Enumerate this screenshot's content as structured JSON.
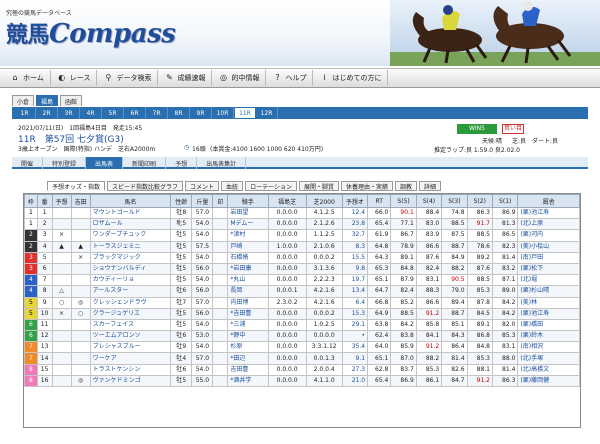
{
  "header": {
    "tagline": "究極の競馬データベース",
    "logo_kanji": "競馬",
    "logo_text": "Compass"
  },
  "nav": [
    {
      "label": "ホーム",
      "icon": "home-icon",
      "glyph": "⌂"
    },
    {
      "label": "レース",
      "icon": "race-icon",
      "glyph": "◐"
    },
    {
      "label": "データ検索",
      "icon": "data-search-icon",
      "glyph": "⚲"
    },
    {
      "label": "成績速報",
      "icon": "results-icon",
      "glyph": "✎"
    },
    {
      "label": "的中情報",
      "icon": "hit-info-icon",
      "glyph": "◎"
    },
    {
      "label": "ヘルプ",
      "icon": "help-icon",
      "glyph": "?"
    },
    {
      "label": "はじめての方に",
      "icon": "beginner-icon",
      "glyph": "i"
    }
  ],
  "venues": [
    "小倉",
    "福島",
    "函館"
  ],
  "active_venue": 1,
  "race_tabs": [
    "1R",
    "2R",
    "3R",
    "4R",
    "5R",
    "6R",
    "7R",
    "8R",
    "9R",
    "10R",
    "11R",
    "12R"
  ],
  "active_race": 10,
  "race": {
    "date_line": "2021/07/11(日)　1回福島4日目　発走15:45",
    "title": "11R　第57回 七夕賞(G3)",
    "conditions": "3歳上オープン　国際(特指) ハンデ　芝右A2000m",
    "runners": "16頭",
    "prize": "(本賞金:4100 1600 1000 620 410万円)",
    "badge_wins": "WIN5",
    "badge_bet": "買い目",
    "weather": "天候:晴",
    "going_label": "芝:良",
    "track_label": "ダート:良",
    "pace": "推定ラップ:良 1.59.0 良2.02.0"
  },
  "sub_tabs": [
    "開催",
    "特別登録",
    "出馬表",
    "新聞印刷",
    "予想",
    "出馬表集計"
  ],
  "active_sub": 2,
  "view_tabs": [
    "予想オッズ・指数",
    "スピード指数比較グラフ",
    "コメント",
    "血統",
    "ローテーション",
    "展開・脚質",
    "休養理由・実績",
    "調教",
    "詳細"
  ],
  "active_view": 0,
  "columns": [
    "枠",
    "番",
    "予想",
    "吉田",
    "馬名",
    "性齢",
    "斤量",
    "印",
    "騎手",
    "福島芝",
    "芝2000",
    "予想オ",
    "RT",
    "S(5)",
    "S(4)",
    "S(3)",
    "S(2)",
    "S(1)",
    "厩舎"
  ],
  "colors": {
    "frame1": "#ffffff",
    "frame2": "#333333",
    "frame3": "#e03030",
    "frame4": "#2a62c8",
    "frame5": "#e8d53a",
    "frame6": "#33a04a",
    "frame7": "#f08a2a",
    "frame8": "#f07ab8"
  },
  "rows": [
    {
      "waku": "1",
      "umaban": "1",
      "pred": "",
      "yoshida": "",
      "name": "マウントゴールド",
      "sexage": "牡8",
      "weight": "57.0",
      "mark": "",
      "jockey": "岩田望",
      "fuku": "0.0.0.0",
      "shiba": "4.1.2.5",
      "odds": "12.4",
      "rt": "66.0",
      "s5": "90.1",
      "s4": "88.4",
      "s3": "74.8",
      "s2": "86.3",
      "s1": "86.9",
      "trainer": "(栗)池江寿"
    },
    {
      "waku": "1",
      "umaban": "2",
      "pred": "",
      "yoshida": "",
      "name": "ロザムール",
      "sexage": "牝5",
      "weight": "54.0",
      "mark": "",
      "jockey": "Mデムー",
      "fuku": "0.0.0.0",
      "shiba": "2.1.2.6",
      "odds": "23.8",
      "rt": "65.4",
      "s5": "77.1",
      "s4": "83.0",
      "s3": "88.5",
      "s2": "91.7",
      "s1": "81.3",
      "trainer": "(北)上原"
    },
    {
      "waku": "2",
      "umaban": "3",
      "pred": "×",
      "yoshida": "",
      "name": "ワンダープチュック",
      "sexage": "牡5",
      "weight": "54.0",
      "mark": "",
      "jockey": "*津村",
      "fuku": "0.0.0.0",
      "shiba": "1.1.2.5",
      "odds": "32.7",
      "rt": "61.9",
      "s5": "86.7",
      "s4": "83.9",
      "s3": "87.5",
      "s2": "88.5",
      "s1": "86.5",
      "trainer": "(栗)河内"
    },
    {
      "waku": "2",
      "umaban": "4",
      "pred": "▲",
      "yoshida": "▲",
      "name": "トーラスジェミニ",
      "sexage": "牡5",
      "weight": "57.5",
      "mark": "",
      "jockey": "戸崎",
      "fuku": "1.0.0.0",
      "shiba": "2.1.0.6",
      "odds": "8.3",
      "rt": "64.8",
      "s5": "78.9",
      "s4": "86.6",
      "s3": "88.7",
      "s2": "78.6",
      "s1": "82.3",
      "trainer": "(美)小桧山"
    },
    {
      "waku": "3",
      "umaban": "5",
      "pred": "",
      "yoshida": "×",
      "name": "ブラックマジック",
      "sexage": "牡5",
      "weight": "54.0",
      "mark": "",
      "jockey": "石橋脩",
      "fuku": "0.0.0.0",
      "shiba": "0.0.0.2",
      "odds": "15.5",
      "rt": "64.3",
      "s5": "89.1",
      "s4": "87.6",
      "s3": "84.9",
      "s2": "89.2",
      "s1": "81.4",
      "trainer": "(南)戸田"
    },
    {
      "waku": "3",
      "umaban": "6",
      "pred": "",
      "yoshida": "",
      "name": "ショウナンバルディ",
      "sexage": "牡5",
      "weight": "56.0",
      "mark": "",
      "jockey": "*岩田康",
      "fuku": "0.0.0.0",
      "shiba": "3.1.3.6",
      "odds": "9.8",
      "rt": "65.3",
      "s5": "84.8",
      "s4": "82.4",
      "s3": "88.2",
      "s2": "87.6",
      "s1": "83.2",
      "trainer": "(栗)松下"
    },
    {
      "waku": "4",
      "umaban": "7",
      "pred": "",
      "yoshida": "",
      "name": "カウディーリョ",
      "sexage": "牡5",
      "weight": "54.0",
      "mark": "",
      "jockey": "*丸山",
      "fuku": "0.0.0.0",
      "shiba": "2.2.2.3",
      "odds": "19.7",
      "rt": "65.1",
      "s5": "87.9",
      "s4": "83.1",
      "s3": "90.5",
      "s2": "88.5",
      "s1": "87.1",
      "trainer": "(北)堀"
    },
    {
      "waku": "4",
      "umaban": "8",
      "pred": "△",
      "yoshida": "",
      "name": "アールスター",
      "sexage": "牡6",
      "weight": "56.0",
      "mark": "",
      "jockey": "長岡",
      "fuku": "0.0.0.1",
      "shiba": "4.2.1.6",
      "odds": "13.4",
      "rt": "64.7",
      "s5": "82.4",
      "s4": "88.3",
      "s3": "79.0",
      "s2": "85.3",
      "s1": "89.0",
      "trainer": "(栗)杉山晴"
    },
    {
      "waku": "5",
      "umaban": "9",
      "pred": "○",
      "yoshida": "◎",
      "name": "クレッシェンドラヴ",
      "sexage": "牡7",
      "weight": "57.0",
      "mark": "",
      "jockey": "内田博",
      "fuku": "2.3.0.2",
      "shiba": "4.2.1.6",
      "odds": "6.4",
      "rt": "66.8",
      "s5": "85.2",
      "s4": "86.6",
      "s3": "89.4",
      "s2": "87.8",
      "s1": "84.2",
      "trainer": "(美)林"
    },
    {
      "waku": "5",
      "umaban": "10",
      "pred": "×",
      "yoshida": "○",
      "name": "クラージュゲリエ",
      "sexage": "牡5",
      "weight": "56.0",
      "mark": "",
      "jockey": "*吉田豊",
      "fuku": "0.0.0.0",
      "shiba": "0.0.0.2",
      "odds": "15.3",
      "rt": "64.9",
      "s5": "88.5",
      "s4": "91.2",
      "s3": "88.7",
      "s2": "84.5",
      "s1": "84.2",
      "trainer": "(栗)池江寿"
    },
    {
      "waku": "6",
      "umaban": "11",
      "pred": "",
      "yoshida": "",
      "name": "スカーフェイス",
      "sexage": "牡5",
      "weight": "54.0",
      "mark": "",
      "jockey": "*三浦",
      "fuku": "0.0.0.0",
      "shiba": "1.0.2.5",
      "odds": "29.1",
      "rt": "63.8",
      "s5": "84.2",
      "s4": "85.8",
      "s3": "85.1",
      "s2": "89.1",
      "s1": "82.0",
      "trainer": "(栗)橋田"
    },
    {
      "waku": "6",
      "umaban": "12",
      "pred": "",
      "yoshida": "",
      "name": "ツーエムアロンソ",
      "sexage": "牡6",
      "weight": "53.0",
      "mark": "",
      "jockey": "*野中",
      "fuku": "0.0.0.0",
      "shiba": "0.0.0.0",
      "odds": "•",
      "rt": "62.4",
      "s5": "83.8",
      "s4": "84.1",
      "s3": "84.3",
      "s2": "86.8",
      "s1": "85.3",
      "trainer": "(栗)鈴木"
    },
    {
      "waku": "7",
      "umaban": "13",
      "pred": "",
      "yoshida": "",
      "name": "ブレシャスブルー",
      "sexage": "牡9",
      "weight": "54.0",
      "mark": "",
      "jockey": "杉原",
      "fuku": "0.0.0.0",
      "shiba": "3.3.1.12",
      "odds": "35.4",
      "rt": "64.0",
      "s5": "85.9",
      "s4": "91.2",
      "s3": "86.4",
      "s2": "84.8",
      "s1": "83.1",
      "trainer": "(南)相沢"
    },
    {
      "waku": "7",
      "umaban": "14",
      "pred": "",
      "yoshida": "",
      "name": "ワーケア",
      "sexage": "牡4",
      "weight": "57.0",
      "mark": "",
      "jockey": "*田辺",
      "fuku": "0.0.0.0",
      "shiba": "0.0.1.3",
      "odds": "9.1",
      "rt": "65.1",
      "s5": "87.0",
      "s4": "88.2",
      "s3": "81.4",
      "s2": "85.3",
      "s1": "88.0",
      "trainer": "(北)手塚"
    },
    {
      "waku": "8",
      "umaban": "15",
      "pred": "",
      "yoshida": "",
      "name": "トラストケンシン",
      "sexage": "牡6",
      "weight": "54.0",
      "mark": "",
      "jockey": "吉田豊",
      "fuku": "0.0.0.0",
      "shiba": "2.0.0.4",
      "odds": "27.3",
      "rt": "62.8",
      "s5": "83.7",
      "s4": "85.3",
      "s3": "82.6",
      "s2": "88.1",
      "s1": "81.4",
      "trainer": "(北)高橋文"
    },
    {
      "waku": "8",
      "umaban": "16",
      "pred": "",
      "yoshida": "◎",
      "name": "ヴァンケドミンゴ",
      "sexage": "牡5",
      "weight": "55.0",
      "mark": "",
      "jockey": "*酒井学",
      "fuku": "0.0.0.0",
      "shiba": "4.1.1.0",
      "odds": "21.0",
      "rt": "65.4",
      "s5": "86.9",
      "s4": "86.1",
      "s3": "84.7",
      "s2": "91.2",
      "s1": "86.3",
      "trainer": "(栗)藤岡健"
    }
  ]
}
